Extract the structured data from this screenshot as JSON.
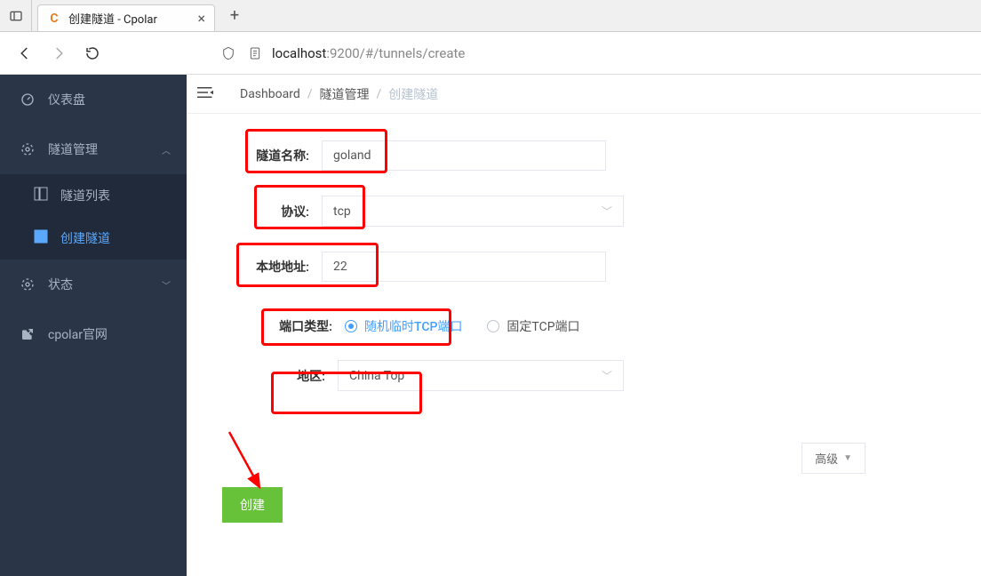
{
  "browser": {
    "tab_title": "创建隧道 - Cpolar",
    "url_host": "localhost",
    "url_path": ":9200/#/tunnels/create",
    "favicon_letter": "C"
  },
  "sidebar": {
    "dashboard": "仪表盘",
    "tunnel_mgmt": "隧道管理",
    "tunnel_list": "隧道列表",
    "tunnel_create": "创建隧道",
    "status": "状态",
    "cpolar_site": "cpolar官网"
  },
  "crumbs": {
    "root": "Dashboard",
    "mid": "隧道管理",
    "leaf": "创建隧道"
  },
  "form": {
    "name_label": "隧道名称:",
    "name_value": "goland",
    "protocol_label": "协议:",
    "protocol_value": "tcp",
    "local_addr_label": "本地地址:",
    "local_addr_value": "22",
    "port_type_label": "端口类型:",
    "port_type_random": "随机临时TCP端口",
    "port_type_fixed": "固定TCP端口",
    "region_label": "地区:",
    "region_value": "China Top",
    "advanced_btn": "高级",
    "submit_btn": "创建"
  }
}
